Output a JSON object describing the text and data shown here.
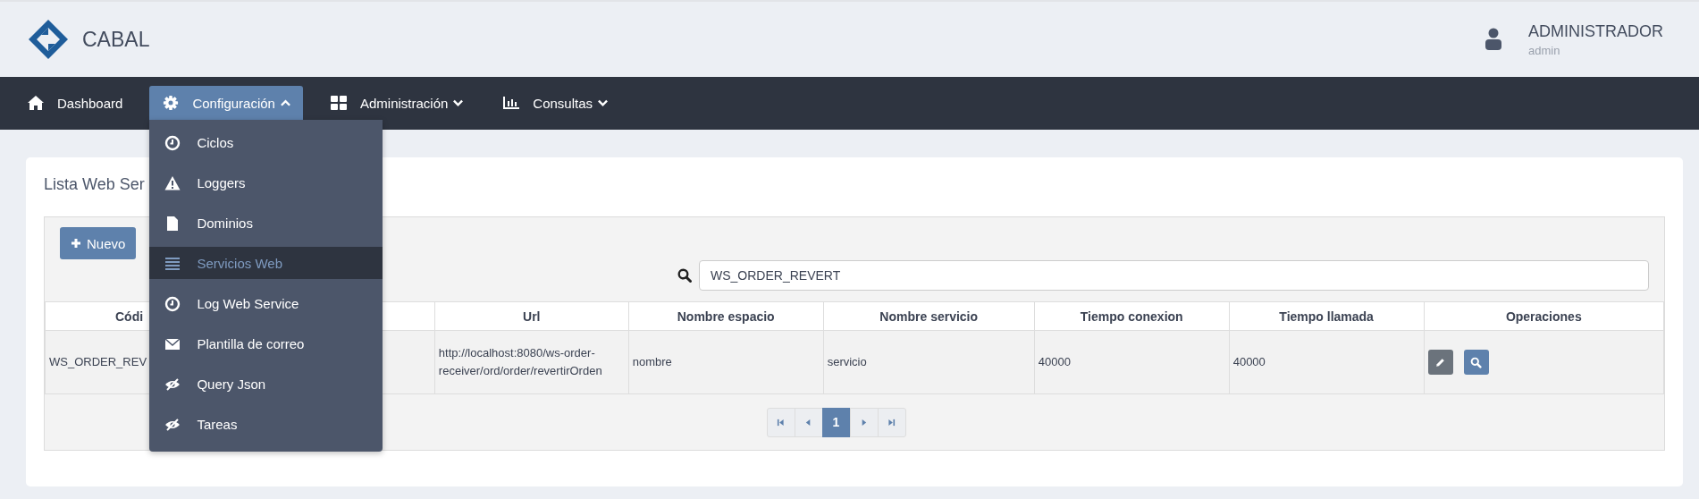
{
  "brand": {
    "name": "CABAL"
  },
  "user": {
    "name": "ADMINISTRADOR",
    "login": "admin"
  },
  "nav": [
    {
      "label": "Dashboard",
      "selected": false
    },
    {
      "label": "Configuración",
      "selected": true,
      "expanded": true,
      "menu": [
        {
          "label": "Ciclos",
          "selected": false
        },
        {
          "label": "Loggers",
          "selected": false
        },
        {
          "label": "Dominios",
          "selected": false
        },
        {
          "label": "Servicios Web",
          "selected": true
        },
        {
          "label": "Log Web Service",
          "selected": false
        },
        {
          "label": "Plantilla de correo",
          "selected": false
        },
        {
          "label": "Query Json",
          "selected": false
        },
        {
          "label": "Tareas",
          "selected": false
        }
      ]
    },
    {
      "label": "Administración",
      "selected": false,
      "expanded": false
    },
    {
      "label": "Consultas",
      "selected": false,
      "expanded": false
    }
  ],
  "card": {
    "title": "Lista Web Ser",
    "new_button": "Nuevo",
    "search": {
      "value": "WS_ORDER_REVERT"
    },
    "table": {
      "columns": [
        "Códi",
        null,
        "Url",
        "Nombre espacio",
        "Nombre servicio",
        "Tiempo conexion",
        "Tiempo llamada",
        "Operaciones"
      ],
      "rows": [
        {
          "cells": [
            "WS_ORDER_REV",
            null,
            "http://localhost:8080/ws-order-receiver/ord/order/revertirOrden",
            "nombre",
            "servicio",
            "40000",
            "40000"
          ]
        }
      ]
    },
    "pager": {
      "pages": [
        {
          "label": "1",
          "selected": true
        }
      ]
    }
  }
}
